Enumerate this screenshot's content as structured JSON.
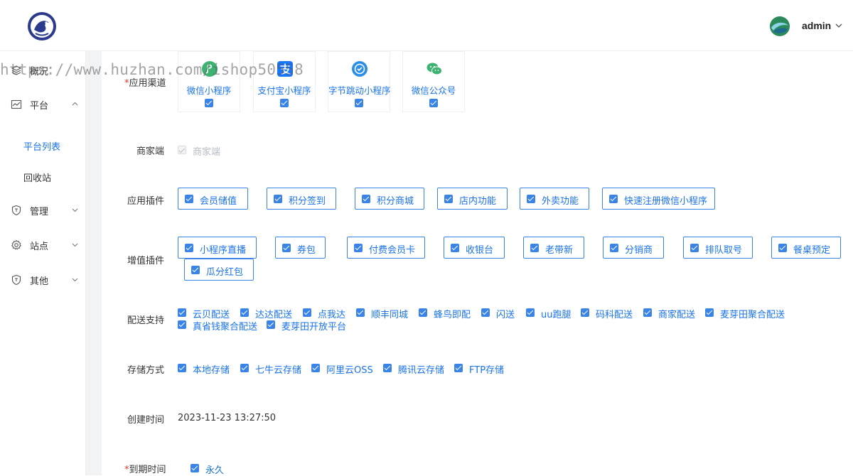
{
  "header": {
    "user_name": "admin"
  },
  "sidebar": {
    "items": [
      {
        "label": "概况",
        "icon": "layers-icon"
      },
      {
        "label": "平台",
        "icon": "chart-icon"
      },
      {
        "label": "管理",
        "icon": "shield-icon"
      },
      {
        "label": "站点",
        "icon": "gear-icon"
      },
      {
        "label": "其他",
        "icon": "shield-icon"
      }
    ],
    "sub_items": [
      {
        "label": "平台列表",
        "active": true
      },
      {
        "label": "回收站",
        "active": false
      }
    ]
  },
  "watermark": "https://www.huzhan.com/ishop50558",
  "form": {
    "channels": {
      "label": "应用渠道",
      "items": [
        {
          "name": "微信小程序",
          "icon": "wechat-mini-program-icon",
          "checked": true
        },
        {
          "name": "支付宝小程序",
          "icon": "alipay-icon",
          "checked": true
        },
        {
          "name": "字节跳动小程序",
          "icon": "bytedance-icon",
          "checked": true
        },
        {
          "name": "微信公众号",
          "icon": "wechat-icon",
          "checked": true
        }
      ]
    },
    "merchant": {
      "label": "商家端",
      "option": "商家端"
    },
    "plugins": {
      "label": "应用插件",
      "items": [
        "会员储值",
        "积分签到",
        "积分商城",
        "店内功能",
        "外卖功能",
        "快速注册微信小程序"
      ]
    },
    "value_added": {
      "label": "增值插件",
      "items": [
        "小程序直播",
        "券包",
        "付费会员卡",
        "收银台",
        "老带新",
        "分销商",
        "排队取号",
        "餐桌预定",
        "瓜分红包"
      ]
    },
    "delivery": {
      "label": "配送支持",
      "items": [
        "云贝配送",
        "达达配送",
        "点我达",
        "顺丰同城",
        "蜂鸟即配",
        "闪送",
        "uu跑腿",
        "码科配送",
        "商家配送",
        "麦芽田聚合配送",
        "真省钱聚合配送",
        "麦芽田开放平台"
      ]
    },
    "storage": {
      "label": "存储方式",
      "items": [
        "本地存储",
        "七牛云存储",
        "阿里云OSS",
        "腾讯云存储",
        "FTP存储"
      ]
    },
    "created": {
      "label": "创建时间",
      "value": "2023-11-23 13:27:50"
    },
    "expire": {
      "label": "到期时间",
      "option": "永久"
    }
  },
  "colors": {
    "accent": "#3a84e8",
    "link": "#1a73e8",
    "required": "#e33333",
    "gutter": "#f2f3f5"
  }
}
